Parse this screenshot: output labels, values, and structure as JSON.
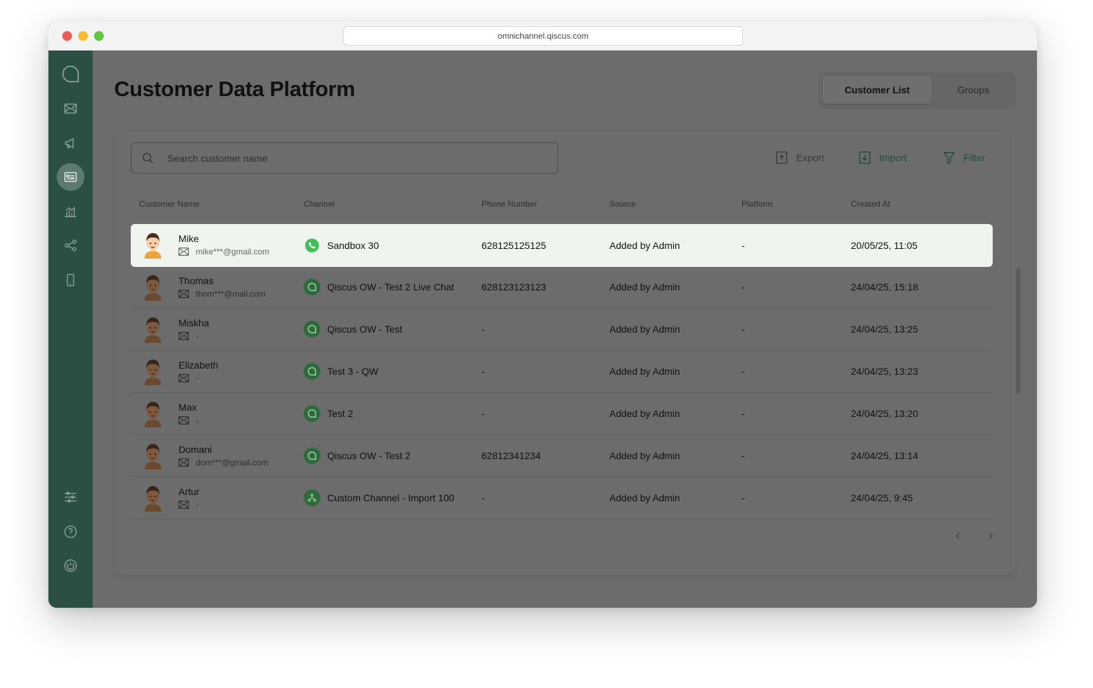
{
  "browser": {
    "url": "omnichannel.qiscus.com"
  },
  "page": {
    "title": "Customer Data Platform"
  },
  "tabs": [
    {
      "label": "Customer List",
      "active": true
    },
    {
      "label": "Groups",
      "active": false
    }
  ],
  "toolbar": {
    "search_placeholder": "Search customer name",
    "export_label": "Export",
    "import_label": "Import",
    "filter_label": "Filter"
  },
  "table": {
    "headers": [
      "Customer Name",
      "Channel",
      "Phone Number",
      "Source",
      "Platform",
      "Created At"
    ],
    "rows": [
      {
        "name": "Mike",
        "email": "mike***@gmail.com",
        "channel": "Sandbox 30",
        "channel_type": "whatsapp",
        "phone": "628125125125",
        "source": "Added by Admin",
        "platform": "-",
        "created": "20/05/25, 11:05"
      },
      {
        "name": "Thomas",
        "email": "thom***@mail.com",
        "channel": "Qiscus OW - Test 2 Live Chat",
        "channel_type": "qiscus",
        "phone": "628123123123",
        "source": "Added by Admin",
        "platform": "-",
        "created": "24/04/25, 15:18"
      },
      {
        "name": "Miskha",
        "email": "-",
        "channel": "Qiscus OW - Test",
        "channel_type": "qiscus",
        "phone": "-",
        "source": "Added by Admin",
        "platform": "-",
        "created": "24/04/25, 13:25"
      },
      {
        "name": "Elizabeth",
        "email": "-",
        "channel": "Test 3 - QW",
        "channel_type": "qiscus",
        "phone": "-",
        "source": "Added by Admin",
        "platform": "-",
        "created": "24/04/25, 13:23"
      },
      {
        "name": "Max",
        "email": "-",
        "channel": "Test 2",
        "channel_type": "qiscus",
        "phone": "-",
        "source": "Added by Admin",
        "platform": "-",
        "created": "24/04/25, 13:20"
      },
      {
        "name": "Domani",
        "email": "dom***@gmail.com",
        "channel": "Qiscus OW - Test 2",
        "channel_type": "qiscus",
        "phone": "62812341234",
        "source": "Added by Admin",
        "platform": "-",
        "created": "24/04/25, 13:14"
      },
      {
        "name": "Artur",
        "email": "-",
        "channel": "Custom Channel - Import 100",
        "channel_type": "custom",
        "phone": "-",
        "source": "Added by Admin",
        "platform": "-",
        "created": "24/04/25, 9:45"
      }
    ]
  },
  "sidebar": {
    "icons": [
      "qiscus-logo-icon",
      "inbox-icon",
      "broadcast-icon",
      "customer-data-icon",
      "analytics-icon",
      "integration-icon",
      "mobile-icon",
      "settings-icon",
      "help-icon",
      "logout-icon"
    ],
    "active": "customer-data-icon"
  },
  "colors": {
    "sidebar_bg": "#2b4f45",
    "accent_green": "#224a3e",
    "highlight_row": "#eff5ee",
    "whatsapp": "#3fbf5a"
  }
}
